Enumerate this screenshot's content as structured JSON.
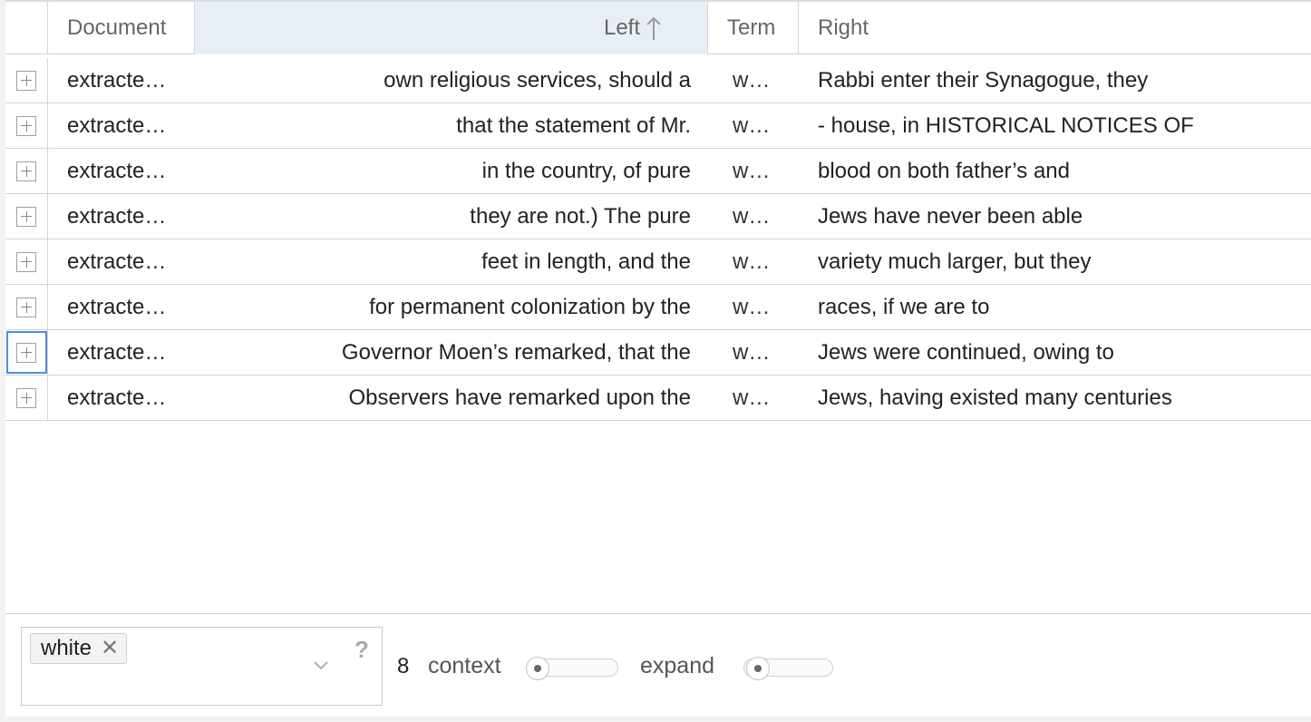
{
  "columns": {
    "document": "Document",
    "left": "Left",
    "term": "Term",
    "right": "Right"
  },
  "sort": {
    "column": "left",
    "direction": "ascending"
  },
  "rows": [
    {
      "document": "extracte…",
      "left": "own religious services, should a",
      "term": "w…",
      "right": "Rabbi enter their Synagogue, they"
    },
    {
      "document": "extracte…",
      "left": "that the statement of Mr.",
      "term": "w…",
      "right": "- house, in HISTORICAL NOTICES OF"
    },
    {
      "document": "extracte…",
      "left": "in the country, of pure",
      "term": "w…",
      "right": "blood on both father’s and"
    },
    {
      "document": "extracte…",
      "left": "they are not.) The pure",
      "term": "w…",
      "right": "Jews have never been able"
    },
    {
      "document": "extracte…",
      "left": "feet in length, and the",
      "term": "w…",
      "right": "variety much larger, but they"
    },
    {
      "document": "extracte…",
      "left": "for permanent colonization by the",
      "term": "w…",
      "right": "races, if we are to"
    },
    {
      "document": "extracte…",
      "left": "Governor Moen’s remarked, that the",
      "term": "w…",
      "right": "Jews were continued, owing to"
    },
    {
      "document": "extracte…",
      "left": "Observers have remarked upon the",
      "term": "w…",
      "right": "Jews, having existed many centuries"
    }
  ],
  "toolbar": {
    "tag": "white",
    "tag_remove_icon": "close-icon",
    "help": "?",
    "count": "8",
    "context_label": "context",
    "expand_label": "expand"
  },
  "colors": {
    "sorted_header": "#e8eef6",
    "focus": "#4a8fd6"
  }
}
